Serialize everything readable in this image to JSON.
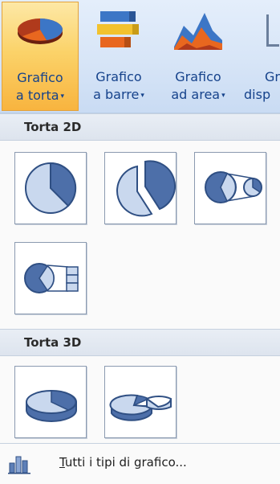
{
  "ribbon": {
    "buttons": [
      {
        "line1": "Grafico",
        "line2": "a torta",
        "icon": "pie-chart-icon",
        "active": true
      },
      {
        "line1": "Grafico",
        "line2": "a barre",
        "icon": "bar-chart-icon",
        "active": false
      },
      {
        "line1": "Grafico",
        "line2": "ad area",
        "icon": "area-chart-icon",
        "active": false
      },
      {
        "line1": "Gr",
        "line2": "disp",
        "icon": "scatter-chart-icon",
        "active": false
      }
    ],
    "dropdown_glyph": "▾"
  },
  "menu": {
    "sections": [
      {
        "title": "Torta 2D",
        "items": [
          "pie-2d-icon",
          "exploded-pie-2d-icon",
          "pie-of-pie-icon",
          "bar-of-pie-icon"
        ]
      },
      {
        "title": "Torta 3D",
        "items": [
          "pie-3d-icon",
          "exploded-pie-3d-icon"
        ]
      }
    ],
    "footer": {
      "first_letter": "T",
      "rest": "utti i tipi di grafico..."
    }
  },
  "colors": {
    "accent": "#f8b43f",
    "pie_blue": "#4d6fa9",
    "pie_light": "#c9d8ee"
  }
}
